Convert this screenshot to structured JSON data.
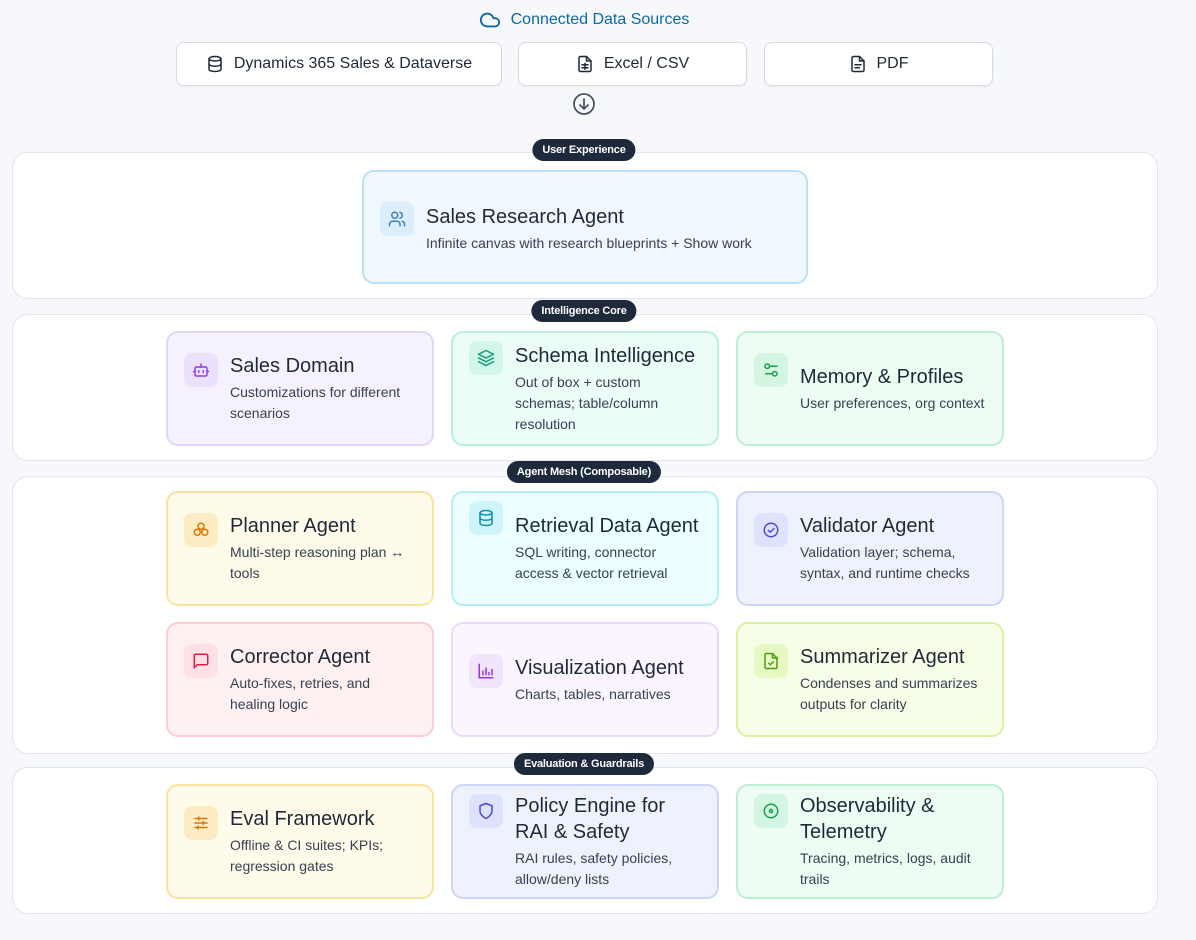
{
  "header": {
    "title": "Connected Data Sources",
    "icon": "cloud-icon"
  },
  "sources": [
    {
      "label": "Dynamics 365 Sales & Dataverse",
      "icon": "database-icon"
    },
    {
      "label": "Excel / CSV",
      "icon": "spreadsheet-file-icon"
    },
    {
      "label": "PDF",
      "icon": "document-icon"
    }
  ],
  "sections": {
    "ux": {
      "label": "User Experience",
      "cards": [
        {
          "title": "Sales Research Agent",
          "desc": "Infinite canvas with research blueprints + Show work",
          "icon": "users-icon"
        }
      ]
    },
    "core": {
      "label": "Intelligence Core",
      "cards": [
        {
          "title": "Sales Domain",
          "desc": "Customizations for different scenarios",
          "icon": "bot-icon"
        },
        {
          "title": "Schema Intelligence",
          "desc": "Out of box + custom schemas; table/column resolution",
          "icon": "layers-icon"
        },
        {
          "title": "Memory & Profiles",
          "desc": "User preferences, org context",
          "icon": "sliders-icon"
        }
      ]
    },
    "mesh": {
      "label": "Agent Mesh (Composable)",
      "cards": [
        {
          "title": "Planner Agent",
          "desc": "Multi-step reasoning plan ↔ tools",
          "icon": "workflow-icon"
        },
        {
          "title": "Retrieval Data Agent",
          "desc": "SQL writing, connector access & vector retrieval",
          "icon": "database-icon"
        },
        {
          "title": "Validator Agent",
          "desc": "Validation layer; schema, syntax, and runtime checks",
          "icon": "check-circle-icon"
        },
        {
          "title": "Corrector Agent",
          "desc": "Auto-fixes, retries, and healing logic",
          "icon": "message-square-icon"
        },
        {
          "title": "Visualization Agent",
          "desc": "Charts, tables, narratives",
          "icon": "bar-chart-icon"
        },
        {
          "title": "Summarizer Agent",
          "desc": "Condenses and summarizes outputs for clarity",
          "icon": "file-summary-icon"
        }
      ]
    },
    "eval": {
      "label": "Evaluation & Guardrails",
      "cards": [
        {
          "title": "Eval Framework",
          "desc": "Offline & CI suites; KPIs; regression gates",
          "icon": "settings-sliders-icon"
        },
        {
          "title": "Policy Engine for RAI & Safety",
          "desc": "RAI rules, safety policies, allow/deny lists",
          "icon": "shield-icon"
        },
        {
          "title": "Observability & Telemetry",
          "desc": "Tracing, metrics, logs, audit trails",
          "icon": "target-icon"
        }
      ]
    }
  }
}
